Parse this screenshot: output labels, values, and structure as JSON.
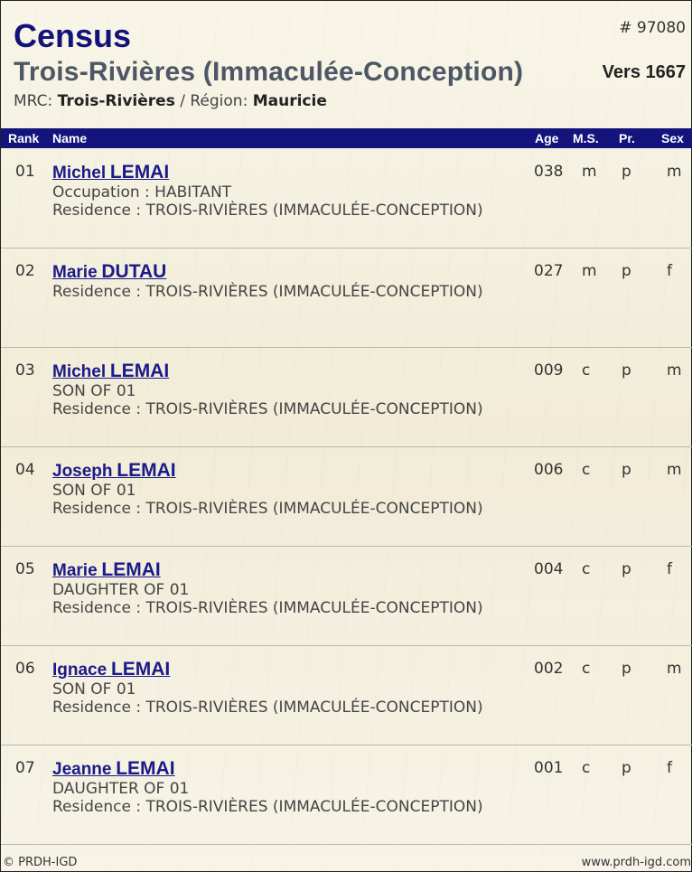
{
  "header": {
    "title": "Census",
    "record_id": "# 97080",
    "place": "Trois-Rivières (Immaculée-Conception)",
    "year": "Vers 1667",
    "mrc_label": "MRC:",
    "mrc_value": "Trois-Rivières",
    "separator": " / ",
    "region_label": "Région:",
    "region_value": "Mauricie"
  },
  "table": {
    "columns": {
      "rank": "Rank",
      "name": "Name",
      "age": "Age",
      "ms": "M.S.",
      "pr": "Pr.",
      "sex": "Sex"
    },
    "rows": [
      {
        "rank": "01",
        "first": "Michel",
        "last": "LEMAI",
        "details": [
          "Occupation : HABITANT",
          "Residence : TROIS-RIVIÈRES (IMMACULÉE-CONCEPTION)"
        ],
        "age": "038",
        "ms": "m",
        "pr": "p",
        "sex": "m"
      },
      {
        "rank": "02",
        "first": "Marie",
        "last": "DUTAU",
        "details": [
          "Residence : TROIS-RIVIÈRES (IMMACULÉE-CONCEPTION)"
        ],
        "age": "027",
        "ms": "m",
        "pr": "p",
        "sex": "f"
      },
      {
        "rank": "03",
        "first": "Michel",
        "last": "LEMAI",
        "details": [
          "SON  OF 01",
          "Residence : TROIS-RIVIÈRES (IMMACULÉE-CONCEPTION)"
        ],
        "age": "009",
        "ms": "c",
        "pr": "p",
        "sex": "m"
      },
      {
        "rank": "04",
        "first": "Joseph",
        "last": "LEMAI",
        "details": [
          "SON  OF 01",
          "Residence : TROIS-RIVIÈRES (IMMACULÉE-CONCEPTION)"
        ],
        "age": "006",
        "ms": "c",
        "pr": "p",
        "sex": "m"
      },
      {
        "rank": "05",
        "first": "Marie",
        "last": "LEMAI",
        "details": [
          "DAUGHTER  OF 01",
          "Residence : TROIS-RIVIÈRES (IMMACULÉE-CONCEPTION)"
        ],
        "age": "004",
        "ms": "c",
        "pr": "p",
        "sex": "f"
      },
      {
        "rank": "06",
        "first": "Ignace",
        "last": "LEMAI",
        "details": [
          "SON  OF 01",
          "Residence : TROIS-RIVIÈRES (IMMACULÉE-CONCEPTION)"
        ],
        "age": "002",
        "ms": "c",
        "pr": "p",
        "sex": "m"
      },
      {
        "rank": "07",
        "first": "Jeanne",
        "last": "LEMAI",
        "details": [
          "DAUGHTER  OF 01",
          "Residence : TROIS-RIVIÈRES (IMMACULÉE-CONCEPTION)"
        ],
        "age": "001",
        "ms": "c",
        "pr": "p",
        "sex": "f"
      }
    ]
  },
  "footer": {
    "copyright": "© PRDH-IGD",
    "url": "www.prdh-igd.com"
  },
  "colors": {
    "accent": "#14147d",
    "title": "#12127a",
    "place": "#4e5766",
    "link": "#1a1a8a"
  }
}
